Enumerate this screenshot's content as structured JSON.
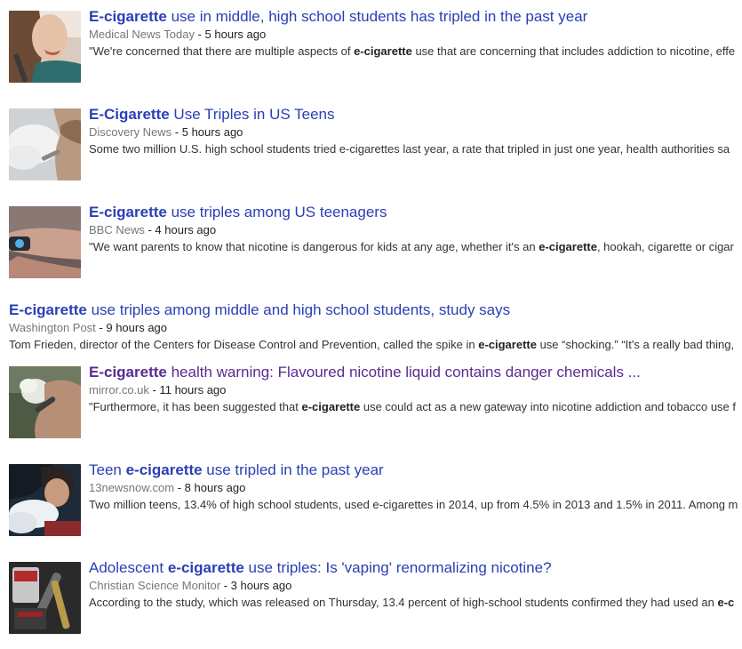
{
  "results": [
    {
      "title_bold": "E-cigarette",
      "title_rest": " use in middle, high school students has tripled in the past year",
      "source": "Medical News Today",
      "time": " - 5 hours ago",
      "snippet_pre": "\"We're concerned that there are multiple aspects of ",
      "snippet_bold": "e-cigarette",
      "snippet_post": " use that are concerning that includes addiction to nicotine, effe",
      "thumb_icon": "woman-vaping-photo"
    },
    {
      "title_bold": "E-Cigarette",
      "title_rest": " Use Triples in US Teens",
      "source": "Discovery News",
      "time": " - 5 hours ago",
      "snippet_pre": "Some two million U.S. high school students tried e-cigarettes last year, a rate that tripled in just one year, health authorities sa",
      "snippet_bold": "",
      "snippet_post": "",
      "thumb_icon": "vapor-cloud-photo"
    },
    {
      "title_bold": "E-cigarette",
      "title_rest": " use triples among US teenagers",
      "source": "BBC News",
      "time": " - 4 hours ago",
      "snippet_pre": "\"We want parents to know that nicotine is dangerous for kids at any age, whether it's an ",
      "snippet_bold": "e-cigarette",
      "snippet_post": ", hookah, cigarette or cigar",
      "thumb_icon": "hand-ecig-photo"
    },
    {
      "title_bold": "E-cigarette",
      "title_rest": " use triples among middle and high school students, study says",
      "source": "Washington Post",
      "time": " - 9 hours ago",
      "snippet_pre": "Tom Frieden, director of the Centers for Disease Control and Prevention, called the spike in ",
      "snippet_bold": "e-cigarette",
      "snippet_post": " use “shocking.” “It's a really bad thing,"
    },
    {
      "title_bold": "E-cigarette",
      "title_rest": " health warning: Flavoured nicotine liquid contains danger chemicals ...",
      "source": "mirror.co.uk",
      "time": " - 11 hours ago",
      "snippet_pre": "\"Furthermore, it has been suggested that ",
      "snippet_bold": "e-cigarette",
      "snippet_post": " use could act as a new gateway into nicotine addiction and tobacco use f",
      "thumb_icon": "person-vaping-photo"
    },
    {
      "title_pre": "Teen ",
      "title_bold": "e-cigarette",
      "title_rest": " use tripled in the past year",
      "source": "13newsnow.com",
      "time": " - 8 hours ago",
      "snippet_pre": "Two million teens, 13.4% of high school students, used e-cigarettes in 2014, up from 4.5% in 2013 and 1.5% in 2011. Among m",
      "snippet_bold": "",
      "snippet_post": "",
      "thumb_icon": "teen-vapor-photo"
    },
    {
      "title_pre": "Adolescent ",
      "title_bold": "e-cigarette",
      "title_rest": " use triples: Is 'vaping' renormalizing nicotine?",
      "source": "Christian Science Monitor",
      "time": " - 3 hours ago",
      "snippet_pre": "According to the study, which was released on Thursday, 13.4 percent of high-school students confirmed they had used an ",
      "snippet_bold": "e-c",
      "snippet_post": "",
      "thumb_icon": "ecig-products-photo"
    }
  ]
}
